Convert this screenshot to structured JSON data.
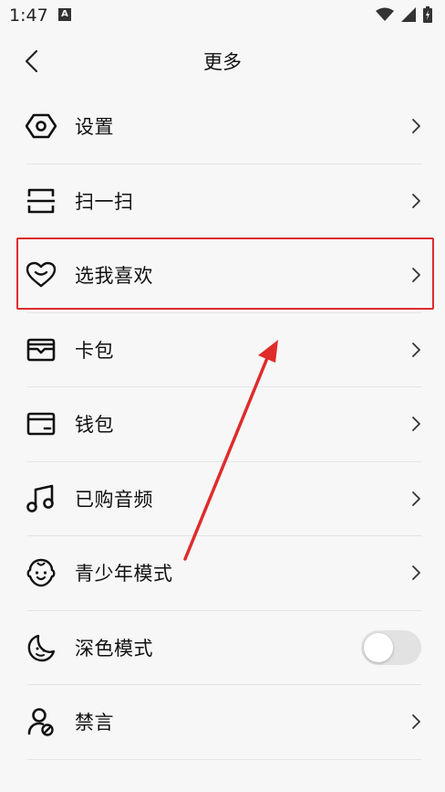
{
  "status_bar": {
    "time": "1:47",
    "notification_letter": "A",
    "icons": [
      "wifi-icon",
      "signal-icon",
      "battery-icon"
    ]
  },
  "header": {
    "title": "更多",
    "back_icon": "back-arrow-icon"
  },
  "menu": [
    {
      "label": "设置",
      "icon": "settings-icon",
      "control": "chevron"
    },
    {
      "label": "扫一扫",
      "icon": "scan-icon",
      "control": "chevron"
    },
    {
      "label": "选我喜欢",
      "icon": "heart-icon",
      "control": "chevron",
      "highlighted": true
    },
    {
      "label": "卡包",
      "icon": "card-wallet-icon",
      "control": "chevron"
    },
    {
      "label": "钱包",
      "icon": "wallet-icon",
      "control": "chevron"
    },
    {
      "label": "已购音频",
      "icon": "music-note-icon",
      "control": "chevron"
    },
    {
      "label": "青少年模式",
      "icon": "child-face-icon",
      "control": "chevron"
    },
    {
      "label": "深色模式",
      "icon": "moon-face-icon",
      "control": "toggle",
      "toggle_on": false
    },
    {
      "label": "禁言",
      "icon": "user-mute-icon",
      "control": "chevron"
    }
  ],
  "colors": {
    "background": "#f7f7f7",
    "annotation_red": "#e02b2b",
    "toggle_off": "#e2e2e2"
  }
}
